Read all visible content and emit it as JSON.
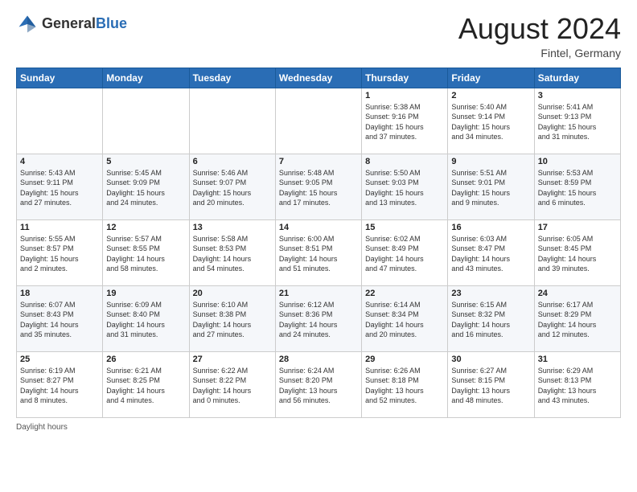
{
  "header": {
    "logo_general": "General",
    "logo_blue": "Blue",
    "month_year": "August 2024",
    "location": "Fintel, Germany"
  },
  "footer": {
    "daylight_label": "Daylight hours"
  },
  "weekdays": [
    "Sunday",
    "Monday",
    "Tuesday",
    "Wednesday",
    "Thursday",
    "Friday",
    "Saturday"
  ],
  "weeks": [
    [
      {
        "day": "",
        "info": ""
      },
      {
        "day": "",
        "info": ""
      },
      {
        "day": "",
        "info": ""
      },
      {
        "day": "",
        "info": ""
      },
      {
        "day": "1",
        "info": "Sunrise: 5:38 AM\nSunset: 9:16 PM\nDaylight: 15 hours\nand 37 minutes."
      },
      {
        "day": "2",
        "info": "Sunrise: 5:40 AM\nSunset: 9:14 PM\nDaylight: 15 hours\nand 34 minutes."
      },
      {
        "day": "3",
        "info": "Sunrise: 5:41 AM\nSunset: 9:13 PM\nDaylight: 15 hours\nand 31 minutes."
      }
    ],
    [
      {
        "day": "4",
        "info": "Sunrise: 5:43 AM\nSunset: 9:11 PM\nDaylight: 15 hours\nand 27 minutes."
      },
      {
        "day": "5",
        "info": "Sunrise: 5:45 AM\nSunset: 9:09 PM\nDaylight: 15 hours\nand 24 minutes."
      },
      {
        "day": "6",
        "info": "Sunrise: 5:46 AM\nSunset: 9:07 PM\nDaylight: 15 hours\nand 20 minutes."
      },
      {
        "day": "7",
        "info": "Sunrise: 5:48 AM\nSunset: 9:05 PM\nDaylight: 15 hours\nand 17 minutes."
      },
      {
        "day": "8",
        "info": "Sunrise: 5:50 AM\nSunset: 9:03 PM\nDaylight: 15 hours\nand 13 minutes."
      },
      {
        "day": "9",
        "info": "Sunrise: 5:51 AM\nSunset: 9:01 PM\nDaylight: 15 hours\nand 9 minutes."
      },
      {
        "day": "10",
        "info": "Sunrise: 5:53 AM\nSunset: 8:59 PM\nDaylight: 15 hours\nand 6 minutes."
      }
    ],
    [
      {
        "day": "11",
        "info": "Sunrise: 5:55 AM\nSunset: 8:57 PM\nDaylight: 15 hours\nand 2 minutes."
      },
      {
        "day": "12",
        "info": "Sunrise: 5:57 AM\nSunset: 8:55 PM\nDaylight: 14 hours\nand 58 minutes."
      },
      {
        "day": "13",
        "info": "Sunrise: 5:58 AM\nSunset: 8:53 PM\nDaylight: 14 hours\nand 54 minutes."
      },
      {
        "day": "14",
        "info": "Sunrise: 6:00 AM\nSunset: 8:51 PM\nDaylight: 14 hours\nand 51 minutes."
      },
      {
        "day": "15",
        "info": "Sunrise: 6:02 AM\nSunset: 8:49 PM\nDaylight: 14 hours\nand 47 minutes."
      },
      {
        "day": "16",
        "info": "Sunrise: 6:03 AM\nSunset: 8:47 PM\nDaylight: 14 hours\nand 43 minutes."
      },
      {
        "day": "17",
        "info": "Sunrise: 6:05 AM\nSunset: 8:45 PM\nDaylight: 14 hours\nand 39 minutes."
      }
    ],
    [
      {
        "day": "18",
        "info": "Sunrise: 6:07 AM\nSunset: 8:43 PM\nDaylight: 14 hours\nand 35 minutes."
      },
      {
        "day": "19",
        "info": "Sunrise: 6:09 AM\nSunset: 8:40 PM\nDaylight: 14 hours\nand 31 minutes."
      },
      {
        "day": "20",
        "info": "Sunrise: 6:10 AM\nSunset: 8:38 PM\nDaylight: 14 hours\nand 27 minutes."
      },
      {
        "day": "21",
        "info": "Sunrise: 6:12 AM\nSunset: 8:36 PM\nDaylight: 14 hours\nand 24 minutes."
      },
      {
        "day": "22",
        "info": "Sunrise: 6:14 AM\nSunset: 8:34 PM\nDaylight: 14 hours\nand 20 minutes."
      },
      {
        "day": "23",
        "info": "Sunrise: 6:15 AM\nSunset: 8:32 PM\nDaylight: 14 hours\nand 16 minutes."
      },
      {
        "day": "24",
        "info": "Sunrise: 6:17 AM\nSunset: 8:29 PM\nDaylight: 14 hours\nand 12 minutes."
      }
    ],
    [
      {
        "day": "25",
        "info": "Sunrise: 6:19 AM\nSunset: 8:27 PM\nDaylight: 14 hours\nand 8 minutes."
      },
      {
        "day": "26",
        "info": "Sunrise: 6:21 AM\nSunset: 8:25 PM\nDaylight: 14 hours\nand 4 minutes."
      },
      {
        "day": "27",
        "info": "Sunrise: 6:22 AM\nSunset: 8:22 PM\nDaylight: 14 hours\nand 0 minutes."
      },
      {
        "day": "28",
        "info": "Sunrise: 6:24 AM\nSunset: 8:20 PM\nDaylight: 13 hours\nand 56 minutes."
      },
      {
        "day": "29",
        "info": "Sunrise: 6:26 AM\nSunset: 8:18 PM\nDaylight: 13 hours\nand 52 minutes."
      },
      {
        "day": "30",
        "info": "Sunrise: 6:27 AM\nSunset: 8:15 PM\nDaylight: 13 hours\nand 48 minutes."
      },
      {
        "day": "31",
        "info": "Sunrise: 6:29 AM\nSunset: 8:13 PM\nDaylight: 13 hours\nand 43 minutes."
      }
    ]
  ]
}
